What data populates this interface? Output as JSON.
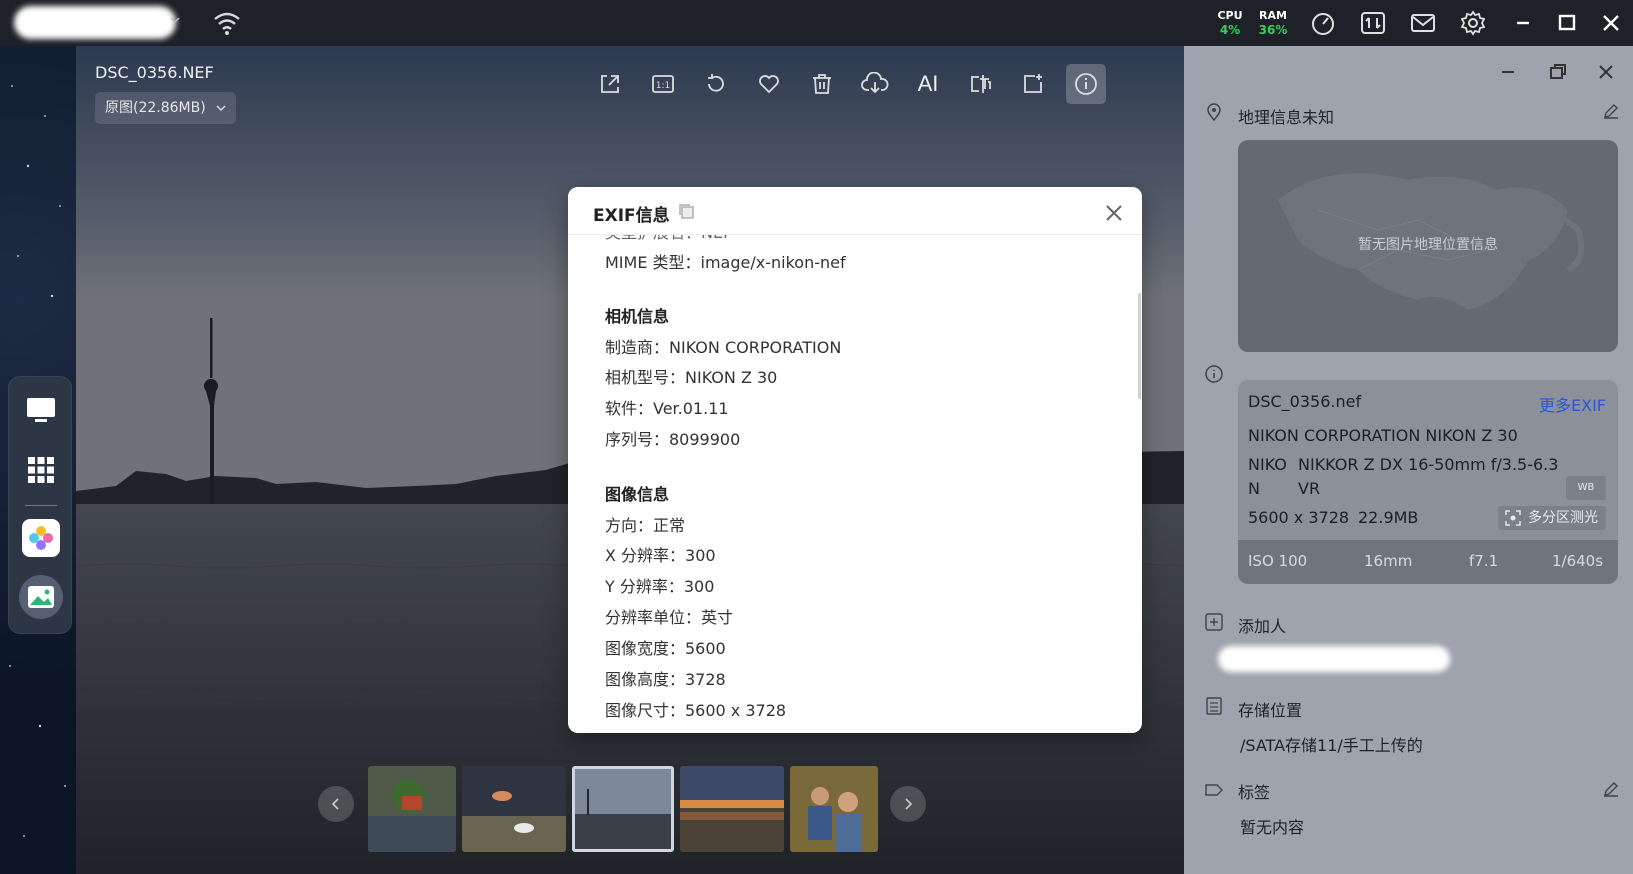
{
  "topbar": {
    "cpu_label": "CPU",
    "cpu_value": "4%",
    "ram_label": "RAM",
    "ram_value": "36%"
  },
  "viewer": {
    "file_name": "DSC_0356.NEF",
    "size_option": "原图(22.86MB)",
    "ai_label": "AI",
    "toolbar_icons": [
      "share-icon",
      "actual-size-icon",
      "rotate-icon",
      "favorite-icon",
      "delete-icon",
      "cloud-download-icon",
      "ai-icon",
      "text-recognition-icon",
      "add-to-album-icon",
      "info-icon"
    ]
  },
  "modal": {
    "title": "EXIF信息",
    "partial_line": "类型扩展名：NEF",
    "lines": {
      "mime": "MIME 类型：image/x-nikon-nef",
      "camera_section": "相机信息",
      "make": "制造商：NIKON CORPORATION",
      "model": "相机型号：NIKON Z 30",
      "software": "软件：Ver.01.11",
      "serial": "序列号：8099900",
      "image_section": "图像信息",
      "orientation": "方向：正常",
      "x_res": "X 分辨率：300",
      "y_res": "Y 分辨率：300",
      "res_unit": "分辨率单位：英寸",
      "width": "图像宽度：5600",
      "height": "图像高度：3728",
      "dims": "图像尺寸：5600 x 3728"
    }
  },
  "panel": {
    "location_title": "地理信息未知",
    "map_text": "暂无图片地理位置信息",
    "exif_card": {
      "file": "DSC_0356.nef",
      "more_link": "更多EXIF",
      "camera": "NIKON CORPORATION NIKON Z 30",
      "lens_brand_1": "NIKO",
      "lens_brand_2": "N",
      "lens_model_1": "NIKKOR Z DX 16-50mm f/3.5-6.3",
      "lens_model_2": "VR",
      "wb_badge": "WB",
      "resolution": "5600 x 3728",
      "filesize": "22.9MB",
      "metering": "多分区测光",
      "iso": "ISO 100",
      "focal": "16mm",
      "aperture": "f7.1",
      "shutter": "1/640s"
    },
    "add_person": "添加人",
    "storage_title": "存储位置",
    "storage_path": "/SATA存储11/手工上传的",
    "tags_title": "标签",
    "tags_value": "暂无内容"
  },
  "colors": {
    "accent_link": "#2a56d6",
    "stat_green": "#35d05a",
    "panel_bg": "#9ea4ae"
  }
}
